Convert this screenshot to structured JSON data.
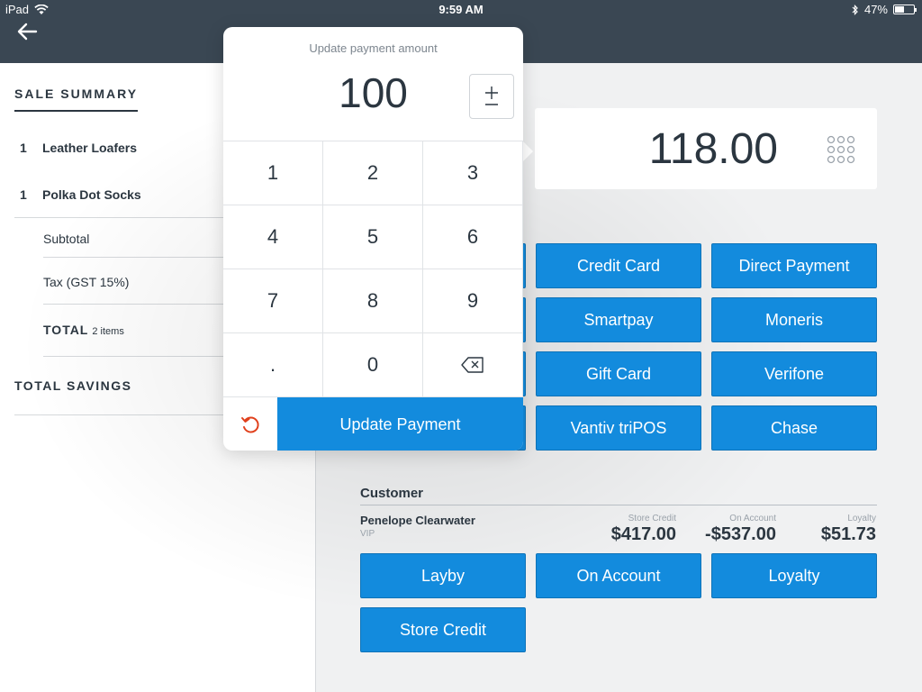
{
  "status_bar": {
    "device": "iPad",
    "time": "9:59 AM",
    "battery": "47%"
  },
  "sidebar": {
    "title": "SALE SUMMARY",
    "items": [
      {
        "qty": "1",
        "name": "Leather Loafers"
      },
      {
        "qty": "1",
        "name": "Polka Dot Socks"
      }
    ],
    "subtotal_label": "Subtotal",
    "tax_label": "Tax (GST 15%)",
    "total_label": "TOTAL",
    "total_items": "2 items",
    "savings_label": "TOTAL SAVINGS"
  },
  "payment": {
    "amount": "118.00",
    "methods": [
      [
        "Credit Card",
        "Direct Payment"
      ],
      [
        "Smartpay",
        "Moneris"
      ],
      [
        "Gift Card",
        "Verifone"
      ],
      [
        "Vantiv triPOS",
        "Chase"
      ]
    ]
  },
  "customer": {
    "title": "Customer",
    "name": "Penelope  Clearwater",
    "tag": "VIP",
    "store_credit_label": "Store Credit",
    "store_credit_value": "$417.00",
    "on_account_label": "On Account",
    "on_account_value": "-$537.00",
    "loyalty_label": "Loyalty",
    "loyalty_value": "$51.73",
    "buttons": [
      "Layby",
      "On Account",
      "Loyalty",
      "Store Credit"
    ]
  },
  "popover": {
    "title": "Update payment amount",
    "amount": "100",
    "keys": [
      "1",
      "2",
      "3",
      "4",
      "5",
      "6",
      "7",
      "8",
      "9",
      ".",
      "0"
    ],
    "update_label": "Update Payment"
  },
  "colors": {
    "topbar": "#3a4753",
    "accent": "#138bdd",
    "undo": "#e0401c"
  }
}
